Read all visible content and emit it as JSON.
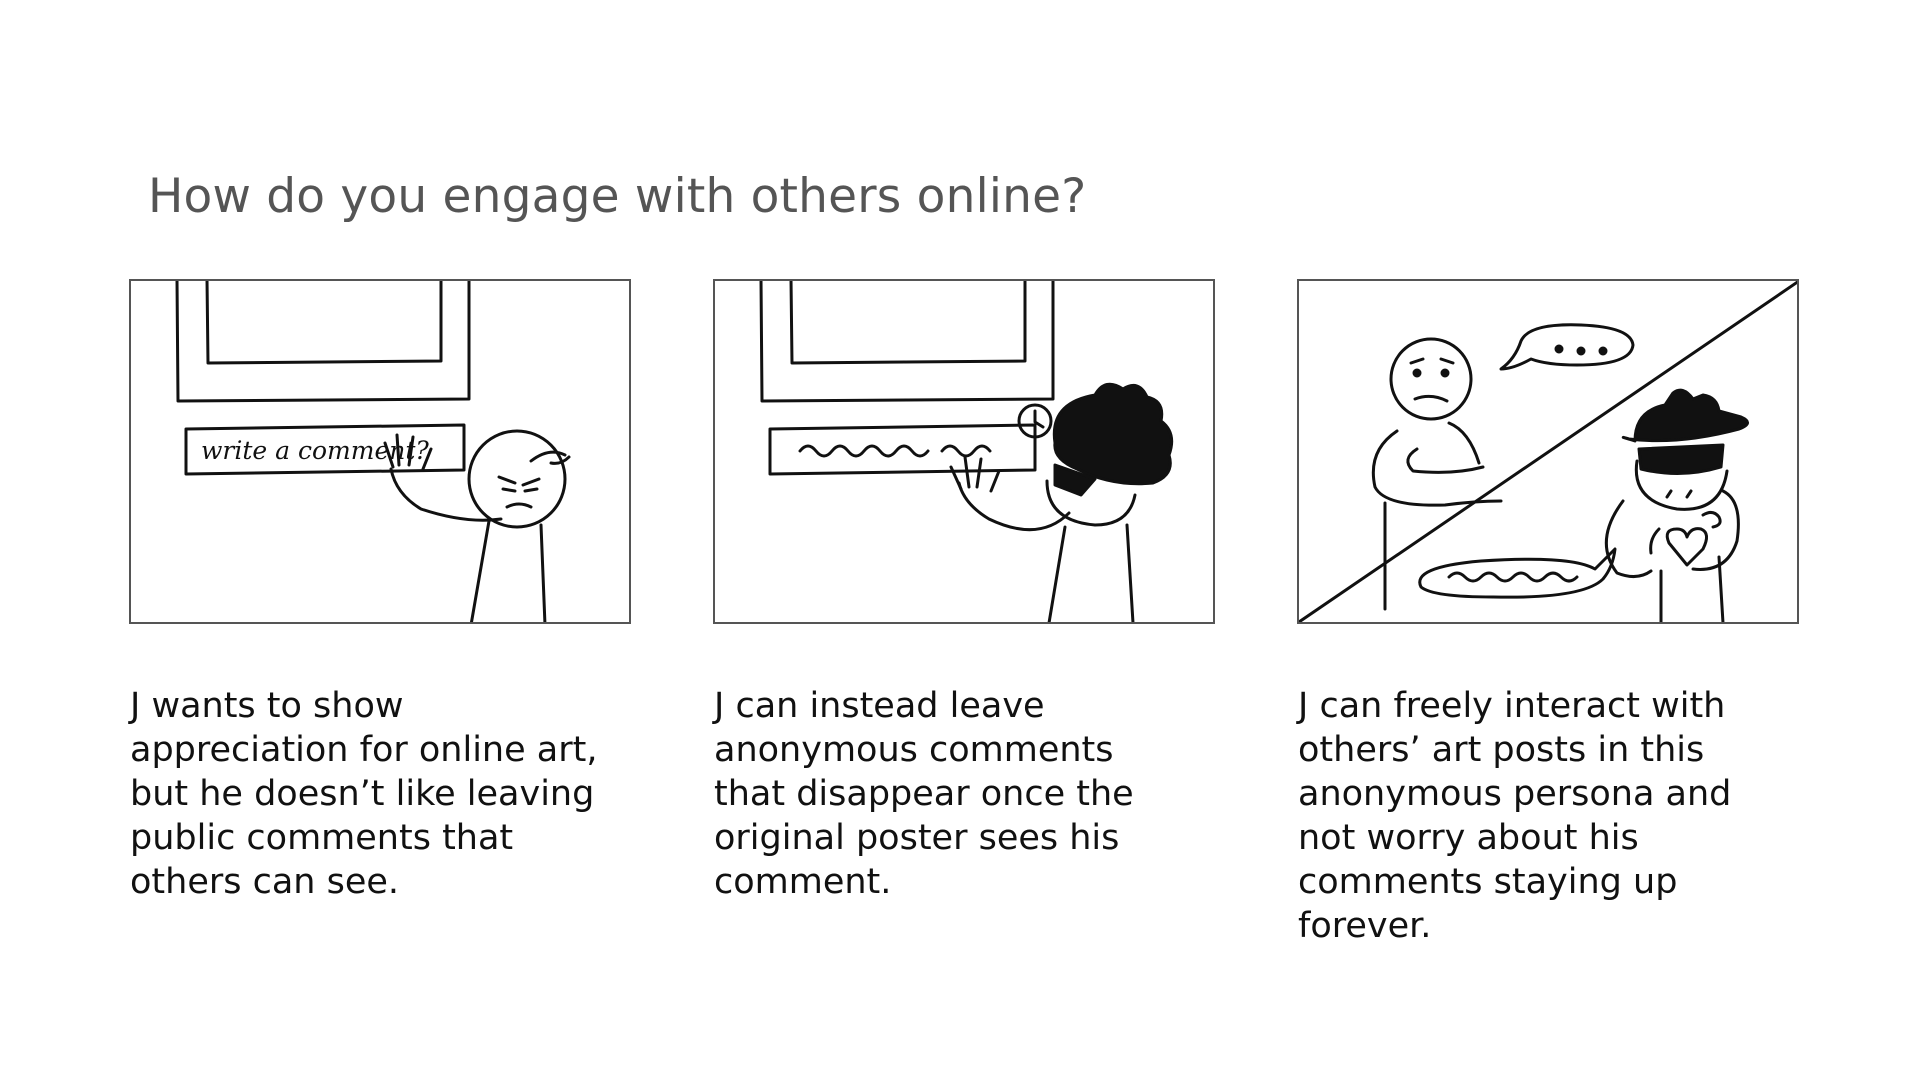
{
  "title": "How do you engage with others online?",
  "panels": [
    {
      "sketch_text": "write a comment?",
      "caption_lines": [
        "J wants to show",
        "appreciation for online art,",
        "but he doesn’t like leaving",
        "public comments that",
        "others can see."
      ]
    },
    {
      "caption_lines": [
        "J can instead leave",
        "anonymous comments",
        "that disappear once the",
        "original poster sees his",
        "comment."
      ]
    },
    {
      "caption_lines": [
        "J can freely interact with",
        "others’ art posts in this",
        "anonymous persona and",
        "not worry about his",
        "comments staying up",
        "forever."
      ]
    }
  ]
}
